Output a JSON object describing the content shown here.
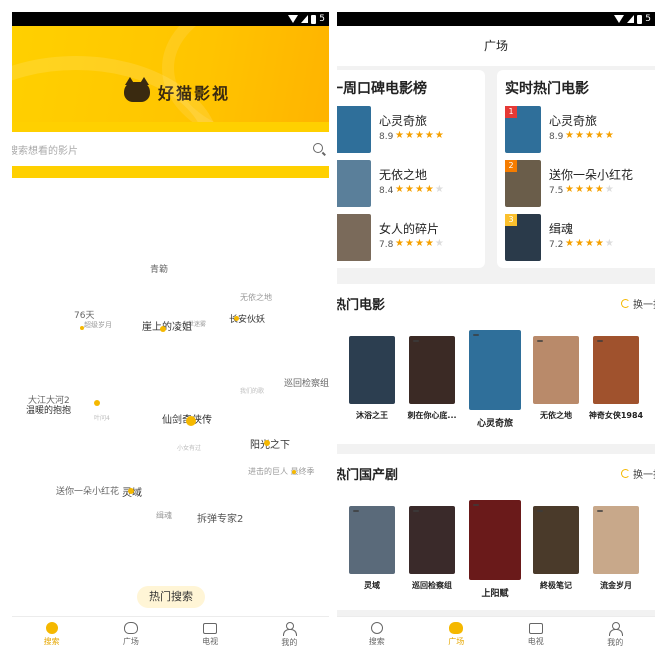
{
  "status_bar": {
    "right_text": "5"
  },
  "left": {
    "logo_text": "好猫影视",
    "search_placeholder": "搜索想看的影片",
    "tags": [
      {
        "text": "青簕",
        "color": "#666"
      },
      {
        "text": "无依之地",
        "color": "#999"
      },
      {
        "text": "76天",
        "color": "#666"
      },
      {
        "text": "长安伙妖",
        "color": "#333"
      },
      {
        "text": "人世迷雾",
        "color": "#999"
      },
      {
        "text": "崖上的凌姐",
        "color": "#333"
      },
      {
        "text": "超级岁月",
        "color": "#999"
      },
      {
        "text": "巡回检察组",
        "color": "#666"
      },
      {
        "text": "我们的歌",
        "color": "#bbb"
      },
      {
        "text": "大江大河2",
        "color": "#666"
      },
      {
        "text": "温暖的抱抱",
        "color": "#333"
      },
      {
        "text": "叶问4",
        "color": "#bbb"
      },
      {
        "text": "仙剑奇侠传",
        "color": "#333"
      },
      {
        "text": "小女有过",
        "color": "#bbb"
      },
      {
        "text": "阳光之下",
        "color": "#333"
      },
      {
        "text": "进击的巨人 最终季",
        "color": "#999"
      },
      {
        "text": "送你一朵小红花",
        "color": "#666"
      },
      {
        "text": "灵域",
        "color": "#333"
      },
      {
        "text": "缉魂",
        "color": "#999"
      },
      {
        "text": "拆弹专家2",
        "color": "#555"
      }
    ],
    "hot_search_label": "热门搜索",
    "tabbar": [
      {
        "label": "搜索",
        "icon": "search-icon",
        "active": true
      },
      {
        "label": "广场",
        "icon": "cat-icon",
        "active": false
      },
      {
        "label": "电视",
        "icon": "tv-icon",
        "active": false
      },
      {
        "label": "我的",
        "icon": "user-icon",
        "active": false
      }
    ]
  },
  "right": {
    "header_title": "广场",
    "rank_cards": [
      {
        "title": "一周口碑电影榜",
        "items": [
          {
            "name": "心灵奇旅",
            "score": "8.9",
            "stars": 4.5,
            "poster_color": "#2f6f9a"
          },
          {
            "name": "无依之地",
            "score": "8.4",
            "stars": 4,
            "poster_color": "#5a7f9a"
          },
          {
            "name": "女人的碎片",
            "score": "7.8",
            "stars": 3.5,
            "poster_color": "#7a6a5a"
          }
        ]
      },
      {
        "title": "实时热门电影",
        "items": [
          {
            "rank": "1",
            "name": "心灵奇旅",
            "score": "8.9",
            "stars": 4.5,
            "poster_color": "#2f6f9a",
            "badge_color": "#e53935"
          },
          {
            "rank": "2",
            "name": "送你一朵小红花",
            "score": "7.5",
            "stars": 3.5,
            "poster_color": "#6a5d4a",
            "badge_color": "#f57c00"
          },
          {
            "rank": "3",
            "name": "缉魂",
            "score": "7.2",
            "stars": 3.5,
            "poster_color": "#2a3a4a",
            "badge_color": "#fbc02d"
          }
        ]
      }
    ],
    "hot_movies": {
      "title": "热门电影",
      "more_label": "换一批",
      "items": [
        {
          "name": "沐浴之王",
          "poster_color": "#2c3e50",
          "hd": false
        },
        {
          "name": "刺在你心底...",
          "poster_color": "#3b2a25",
          "hd": true
        },
        {
          "name": "心灵奇旅",
          "poster_color": "#2f6f9a",
          "hd": true
        },
        {
          "name": "无依之地",
          "poster_color": "#b98a6a",
          "hd": true
        },
        {
          "name": "神奇女侠1984",
          "poster_color": "#a0522d",
          "hd": true
        }
      ]
    },
    "hot_tv": {
      "title": "热门国产剧",
      "more_label": "换一批",
      "items": [
        {
          "name": "灵域",
          "poster_color": "#5a6a7a",
          "hd": true
        },
        {
          "name": "巡回检察组",
          "poster_color": "#3a2a2a",
          "hd": true
        },
        {
          "name": "上阳赋",
          "poster_color": "#6a1a1a",
          "hd": true
        },
        {
          "name": "終极笔记",
          "poster_color": "#4a3a2a",
          "hd": true
        },
        {
          "name": "流金岁月",
          "poster_color": "#c8a88a",
          "hd": true
        }
      ]
    },
    "tabbar": [
      {
        "label": "搜索",
        "icon": "search-icon",
        "active": false
      },
      {
        "label": "广场",
        "icon": "cat-icon",
        "active": true
      },
      {
        "label": "电视",
        "icon": "tv-icon",
        "active": false
      },
      {
        "label": "我的",
        "icon": "user-icon",
        "active": false
      }
    ]
  }
}
